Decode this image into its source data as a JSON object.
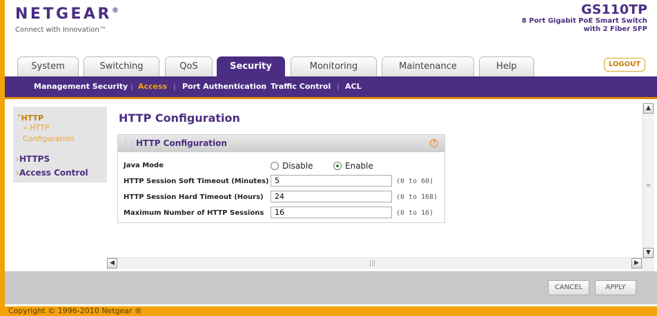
{
  "header": {
    "brand": "NETGEAR",
    "brand_mark": "®",
    "tagline": "Connect with Innovation™",
    "model": "GS110TP",
    "description_line1": "8 Port Gigabit PoE Smart Switch",
    "description_line2": "with 2 Fiber SFP"
  },
  "tabs": [
    {
      "label": "System"
    },
    {
      "label": "Switching"
    },
    {
      "label": "QoS"
    },
    {
      "label": "Security",
      "active": true
    },
    {
      "label": "Monitoring"
    },
    {
      "label": "Maintenance"
    },
    {
      "label": "Help"
    }
  ],
  "logout_label": "LOGOUT",
  "subnav": {
    "items": [
      "Management Security",
      "Access",
      "Port Authentication",
      "Traffic Control",
      "ACL"
    ],
    "active": "Access",
    "separator": "|"
  },
  "sidebar": {
    "http_label": "HTTP",
    "http_config_line1": "» HTTP",
    "http_config_line2": "Configuration",
    "https_label": "HTTPS",
    "access_control_label": "Access Control"
  },
  "page_title": "HTTP Configuration",
  "panel": {
    "title": "HTTP Configuration",
    "help_icon": "?",
    "java_mode_label": "Java Mode",
    "java_options": [
      "Disable",
      "Enable"
    ],
    "java_selected": "Enable",
    "fields": [
      {
        "label": "HTTP Session Soft Timeout (Minutes)",
        "value": "5",
        "range": "(0 to 60)"
      },
      {
        "label": "HTTP Session Hard Timeout (Hours)",
        "value": "24",
        "range": "(0 to 168)"
      },
      {
        "label": "Maximum Number of HTTP Sessions",
        "value": "16",
        "range": "(0 to 16)"
      }
    ]
  },
  "buttons": {
    "cancel": "CANCEL",
    "apply": "APPLY"
  },
  "copyright": "Copyright © 1996-2010 Netgear ®",
  "colors": {
    "brand_purple": "#4b2e83",
    "accent_orange": "#f4a20a"
  }
}
